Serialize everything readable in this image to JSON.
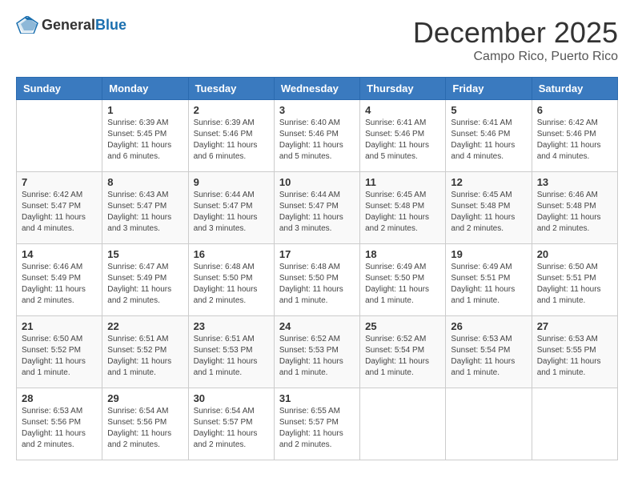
{
  "header": {
    "logo": {
      "general": "General",
      "blue": "Blue"
    },
    "month": "December 2025",
    "location": "Campo Rico, Puerto Rico"
  },
  "weekdays": [
    "Sunday",
    "Monday",
    "Tuesday",
    "Wednesday",
    "Thursday",
    "Friday",
    "Saturday"
  ],
  "weeks": [
    [
      {
        "day": "",
        "info": ""
      },
      {
        "day": "1",
        "info": "Sunrise: 6:39 AM\nSunset: 5:45 PM\nDaylight: 11 hours\nand 6 minutes."
      },
      {
        "day": "2",
        "info": "Sunrise: 6:39 AM\nSunset: 5:46 PM\nDaylight: 11 hours\nand 6 minutes."
      },
      {
        "day": "3",
        "info": "Sunrise: 6:40 AM\nSunset: 5:46 PM\nDaylight: 11 hours\nand 5 minutes."
      },
      {
        "day": "4",
        "info": "Sunrise: 6:41 AM\nSunset: 5:46 PM\nDaylight: 11 hours\nand 5 minutes."
      },
      {
        "day": "5",
        "info": "Sunrise: 6:41 AM\nSunset: 5:46 PM\nDaylight: 11 hours\nand 4 minutes."
      },
      {
        "day": "6",
        "info": "Sunrise: 6:42 AM\nSunset: 5:46 PM\nDaylight: 11 hours\nand 4 minutes."
      }
    ],
    [
      {
        "day": "7",
        "info": "Sunrise: 6:42 AM\nSunset: 5:47 PM\nDaylight: 11 hours\nand 4 minutes."
      },
      {
        "day": "8",
        "info": "Sunrise: 6:43 AM\nSunset: 5:47 PM\nDaylight: 11 hours\nand 3 minutes."
      },
      {
        "day": "9",
        "info": "Sunrise: 6:44 AM\nSunset: 5:47 PM\nDaylight: 11 hours\nand 3 minutes."
      },
      {
        "day": "10",
        "info": "Sunrise: 6:44 AM\nSunset: 5:47 PM\nDaylight: 11 hours\nand 3 minutes."
      },
      {
        "day": "11",
        "info": "Sunrise: 6:45 AM\nSunset: 5:48 PM\nDaylight: 11 hours\nand 2 minutes."
      },
      {
        "day": "12",
        "info": "Sunrise: 6:45 AM\nSunset: 5:48 PM\nDaylight: 11 hours\nand 2 minutes."
      },
      {
        "day": "13",
        "info": "Sunrise: 6:46 AM\nSunset: 5:48 PM\nDaylight: 11 hours\nand 2 minutes."
      }
    ],
    [
      {
        "day": "14",
        "info": "Sunrise: 6:46 AM\nSunset: 5:49 PM\nDaylight: 11 hours\nand 2 minutes."
      },
      {
        "day": "15",
        "info": "Sunrise: 6:47 AM\nSunset: 5:49 PM\nDaylight: 11 hours\nand 2 minutes."
      },
      {
        "day": "16",
        "info": "Sunrise: 6:48 AM\nSunset: 5:50 PM\nDaylight: 11 hours\nand 2 minutes."
      },
      {
        "day": "17",
        "info": "Sunrise: 6:48 AM\nSunset: 5:50 PM\nDaylight: 11 hours\nand 1 minute."
      },
      {
        "day": "18",
        "info": "Sunrise: 6:49 AM\nSunset: 5:50 PM\nDaylight: 11 hours\nand 1 minute."
      },
      {
        "day": "19",
        "info": "Sunrise: 6:49 AM\nSunset: 5:51 PM\nDaylight: 11 hours\nand 1 minute."
      },
      {
        "day": "20",
        "info": "Sunrise: 6:50 AM\nSunset: 5:51 PM\nDaylight: 11 hours\nand 1 minute."
      }
    ],
    [
      {
        "day": "21",
        "info": "Sunrise: 6:50 AM\nSunset: 5:52 PM\nDaylight: 11 hours\nand 1 minute."
      },
      {
        "day": "22",
        "info": "Sunrise: 6:51 AM\nSunset: 5:52 PM\nDaylight: 11 hours\nand 1 minute."
      },
      {
        "day": "23",
        "info": "Sunrise: 6:51 AM\nSunset: 5:53 PM\nDaylight: 11 hours\nand 1 minute."
      },
      {
        "day": "24",
        "info": "Sunrise: 6:52 AM\nSunset: 5:53 PM\nDaylight: 11 hours\nand 1 minute."
      },
      {
        "day": "25",
        "info": "Sunrise: 6:52 AM\nSunset: 5:54 PM\nDaylight: 11 hours\nand 1 minute."
      },
      {
        "day": "26",
        "info": "Sunrise: 6:53 AM\nSunset: 5:54 PM\nDaylight: 11 hours\nand 1 minute."
      },
      {
        "day": "27",
        "info": "Sunrise: 6:53 AM\nSunset: 5:55 PM\nDaylight: 11 hours\nand 1 minute."
      }
    ],
    [
      {
        "day": "28",
        "info": "Sunrise: 6:53 AM\nSunset: 5:56 PM\nDaylight: 11 hours\nand 2 minutes."
      },
      {
        "day": "29",
        "info": "Sunrise: 6:54 AM\nSunset: 5:56 PM\nDaylight: 11 hours\nand 2 minutes."
      },
      {
        "day": "30",
        "info": "Sunrise: 6:54 AM\nSunset: 5:57 PM\nDaylight: 11 hours\nand 2 minutes."
      },
      {
        "day": "31",
        "info": "Sunrise: 6:55 AM\nSunset: 5:57 PM\nDaylight: 11 hours\nand 2 minutes."
      },
      {
        "day": "",
        "info": ""
      },
      {
        "day": "",
        "info": ""
      },
      {
        "day": "",
        "info": ""
      }
    ]
  ]
}
